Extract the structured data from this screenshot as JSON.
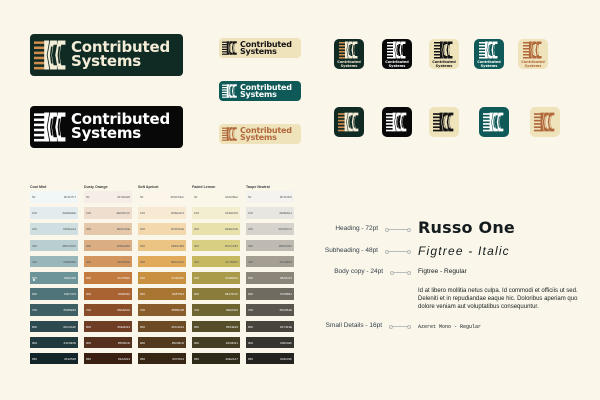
{
  "brand": {
    "name_line1": "Contributed",
    "name_line2": "Systems"
  },
  "colors": {
    "dark_green": "#102a24",
    "black": "#080808",
    "teal": "#0f5a58",
    "cream": "#efe3bc",
    "orange": "#cf8d4e",
    "light_cream": "#f5eedd"
  },
  "palette": [
    {
      "name": "Cool Mint",
      "swatches": [
        {
          "step": "50",
          "hex": "#F3F7F7",
          "color": "#f1f6f7"
        },
        {
          "step": "100",
          "hex": "#E8EEEE",
          "color": "#e2ecee"
        },
        {
          "step": "200",
          "hex": "#D6E1E3",
          "color": "#cfdfe1"
        },
        {
          "step": "300",
          "hex": "#B8CDD0",
          "color": "#b8ced1"
        },
        {
          "step": "400",
          "hex": "#99B6BA",
          "color": "#99b6ba"
        },
        {
          "step": "500",
          "hex": "#6E9499",
          "color": "#6d9499"
        },
        {
          "step": "600",
          "hex": "#4F7479",
          "color": "#4f7479"
        },
        {
          "step": "700",
          "hex": "#3D5E63",
          "color": "#3d5e63"
        },
        {
          "step": "800",
          "hex": "#2C4A4F",
          "color": "#2c4a4f"
        },
        {
          "step": "900",
          "hex": "#1F393D",
          "color": "#1f393d"
        },
        {
          "step": "950",
          "hex": "#132528",
          "color": "#132528"
        }
      ]
    },
    {
      "name": "Dusty Orange",
      "swatches": [
        {
          "step": "50",
          "hex": "#F7EFE8",
          "color": "#f6eee6"
        },
        {
          "step": "100",
          "hex": "#EFDFCF",
          "color": "#efdecd"
        },
        {
          "step": "200",
          "hex": "#E6C9AE",
          "color": "#e5c7aa"
        },
        {
          "step": "300",
          "hex": "#DBAE85",
          "color": "#dbad83"
        },
        {
          "step": "400",
          "hex": "#D2945E",
          "color": "#d2955e"
        },
        {
          "step": "500",
          "hex": "#C47B3F",
          "color": "#c47b3f"
        },
        {
          "step": "600",
          "hex": "#A96232",
          "color": "#a96232"
        },
        {
          "step": "700",
          "hex": "#8A4D2A",
          "color": "#8a4d2a"
        },
        {
          "step": "800",
          "hex": "#6E3D24",
          "color": "#6e3d24"
        },
        {
          "step": "900",
          "hex": "#55301D",
          "color": "#55301d"
        },
        {
          "step": "950",
          "hex": "#3A2013",
          "color": "#3a2013"
        }
      ]
    },
    {
      "name": "Soft Apricot",
      "swatches": [
        {
          "step": "50",
          "hex": "#FDF6EC",
          "color": "#fcf5ea"
        },
        {
          "step": "100",
          "hex": "#F8EAD4",
          "color": "#f8e9d2"
        },
        {
          "step": "200",
          "hex": "#F2D9AE",
          "color": "#f2d8ac"
        },
        {
          "step": "300",
          "hex": "#EBC483",
          "color": "#ebc383"
        },
        {
          "step": "400",
          "hex": "#E0AA5A",
          "color": "#e0aa5a"
        },
        {
          "step": "500",
          "hex": "#C9903F",
          "color": "#c9903f"
        },
        {
          "step": "600",
          "hex": "#A87533",
          "color": "#a87533"
        },
        {
          "step": "700",
          "hex": "#885D2B",
          "color": "#885d2b"
        },
        {
          "step": "800",
          "hex": "#6C4A24",
          "color": "#6c4a24"
        },
        {
          "step": "900",
          "hex": "#52391D",
          "color": "#52391d"
        },
        {
          "step": "950",
          "hex": "#372613",
          "color": "#372613"
        }
      ]
    },
    {
      "name": "Faded Lemon",
      "swatches": [
        {
          "step": "50",
          "hex": "#FAF8EA",
          "color": "#faf7e8"
        },
        {
          "step": "100",
          "hex": "#F3EFD0",
          "color": "#f3eecf"
        },
        {
          "step": "200",
          "hex": "#E9E2AE",
          "color": "#e8e1ab"
        },
        {
          "step": "300",
          "hex": "#DACF85",
          "color": "#d9cf83"
        },
        {
          "step": "400",
          "hex": "#C7B961",
          "color": "#c6b860"
        },
        {
          "step": "500",
          "hex": "#A99B4A",
          "color": "#a99b4a"
        },
        {
          "step": "600",
          "hex": "#8A7D3C",
          "color": "#8a7d3c"
        },
        {
          "step": "700",
          "hex": "#6E6432",
          "color": "#6e6432"
        },
        {
          "step": "800",
          "hex": "#564E29",
          "color": "#564e29"
        },
        {
          "step": "900",
          "hex": "#433D21",
          "color": "#433d21"
        },
        {
          "step": "950",
          "hex": "#2E2A17",
          "color": "#2e2a17"
        }
      ]
    },
    {
      "name": "Taupe Neutral",
      "swatches": [
        {
          "step": "50",
          "hex": "#F4F3F0",
          "color": "#f4f3f0"
        },
        {
          "step": "100",
          "hex": "#E8E6E1",
          "color": "#e8e6e1"
        },
        {
          "step": "200",
          "hex": "#D6D3CC",
          "color": "#d6d3cc"
        },
        {
          "step": "300",
          "hex": "#BFBAB1",
          "color": "#bfbab1"
        },
        {
          "step": "400",
          "hex": "#A49E93",
          "color": "#a49e93"
        },
        {
          "step": "500",
          "hex": "#8A8479",
          "color": "#8a8479"
        },
        {
          "step": "600",
          "hex": "#706B61",
          "color": "#706b61"
        },
        {
          "step": "700",
          "hex": "#5A564E",
          "color": "#5a564e"
        },
        {
          "step": "800",
          "hex": "#47443E",
          "color": "#47443e"
        },
        {
          "step": "900",
          "hex": "#36342F",
          "color": "#36342f"
        },
        {
          "step": "950",
          "hex": "#24231F",
          "color": "#24231f"
        }
      ]
    }
  ],
  "typography": {
    "heading_label": "Heading - 72pt",
    "heading_sample": "Russo One",
    "subheading_label": "Subheading - 48pt",
    "subheading_sample": "Figtree - Italic",
    "body_label": "Body copy - 24pt",
    "body_sample": "Figtree - Regular",
    "paragraph": "Id at libero mollitia netus culpa. Id commodi et officiis ut sed. Deleniti et in repudiandae eaque hic. Doloribus aperiam quo dolore veniam aut voluptatibus consequuntur.",
    "small_label": "Small Details - 16pt",
    "small_sample": "Azeret Mono - Regular"
  }
}
